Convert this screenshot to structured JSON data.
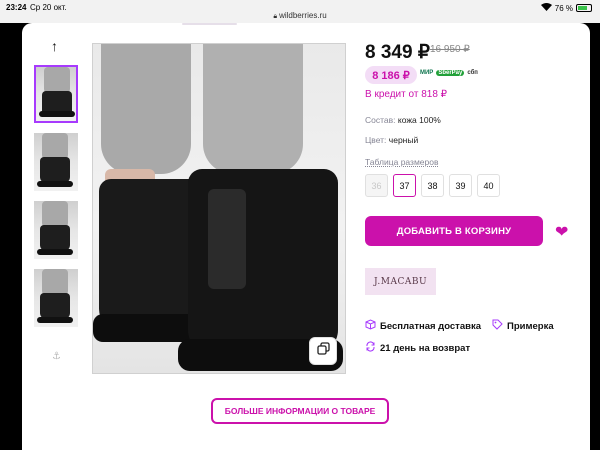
{
  "status_bar": {
    "time": "23:24",
    "date": "Ср 20 окт.",
    "url": "wildberries.ru",
    "battery": "76 %",
    "battery_level": 0.76
  },
  "thumbnails": [
    {
      "label": "photo-1",
      "active": true
    },
    {
      "label": "photo-2",
      "active": false
    },
    {
      "label": "photo-3",
      "active": false
    },
    {
      "label": "photo-4",
      "active": false
    }
  ],
  "product": {
    "price": "8 349 ₽",
    "old_price": "16 950 ₽",
    "wallet_price": "8 186 ₽",
    "pay_logos": {
      "mir": "МИР",
      "sber": "SberPay",
      "sbp": "сбп"
    },
    "credit": "В кредит от 818 ₽",
    "composition_key": "Состав:",
    "composition_value": "кожа 100%",
    "color_key": "Цвет:",
    "color_value": "черный",
    "size_table": "Таблица размеров",
    "sizes": [
      {
        "label": "36",
        "state": "disabled"
      },
      {
        "label": "37",
        "state": "selected"
      },
      {
        "label": "38",
        "state": "normal"
      },
      {
        "label": "39",
        "state": "normal"
      },
      {
        "label": "40",
        "state": "normal"
      }
    ],
    "add_to_cart": "ДОБАВИТЬ В КОРЗИНУ",
    "brand": "J.MACABU",
    "features": {
      "delivery": "Бесплатная доставка",
      "fitting": "Примерка",
      "return": "21 день на возврат"
    },
    "more_info": "БОЛЬШЕ ИНФОРМАЦИИ О ТОВАРЕ"
  },
  "colors": {
    "accent": "#cb11ab",
    "accent_light": "#f3ddf6",
    "thumb_active": "#a73afd"
  }
}
